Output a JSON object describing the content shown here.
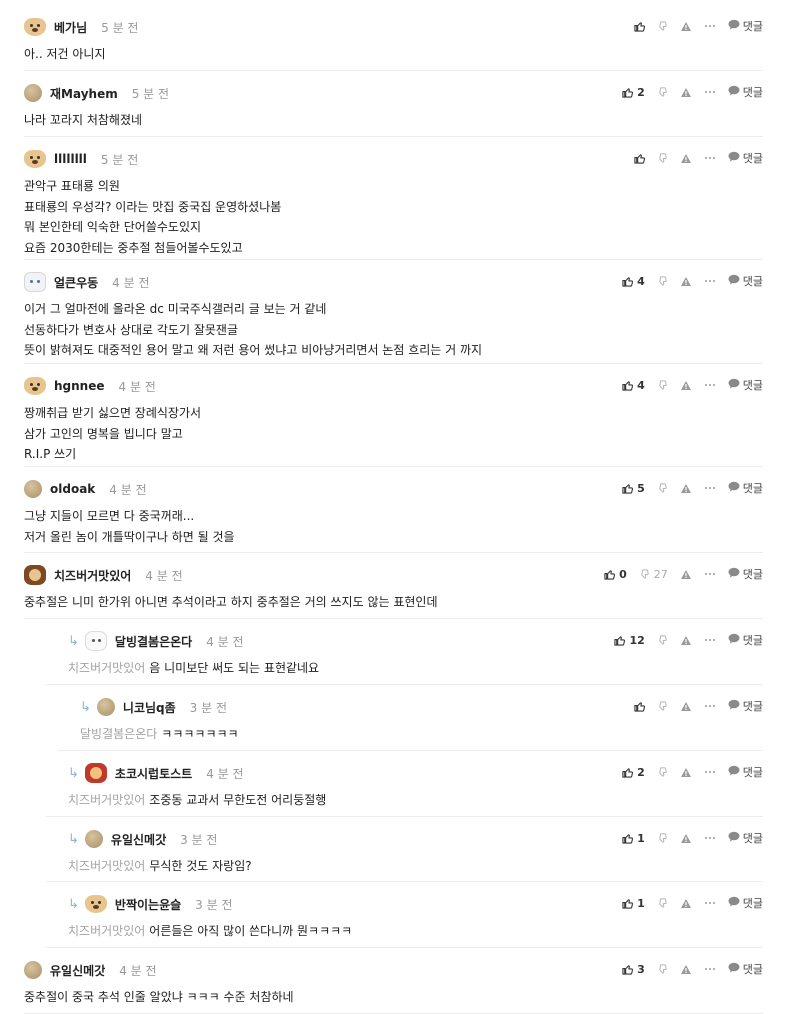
{
  "reply_label": "댓글",
  "comments": [
    {
      "nick": "베가님",
      "time": "5 분 전",
      "likes": "",
      "body": "아.. 저건 아니지",
      "avatar": "dog"
    },
    {
      "nick": "재Mayhem",
      "time": "5 분 전",
      "likes": "2",
      "body": "나라 꼬라지 처참해졌네",
      "avatar": "circle"
    },
    {
      "nick": "llllllll",
      "time": "5 분 전",
      "likes": "",
      "body": "관악구 표태룡 의원\n표태룡의 우성각? 이라는 맛집 중국집 운영하셨나봄\n뭐 본인한테 익숙한 단어쓸수도있지\n요즘 2030한테는 중추절 첨들어볼수도있고",
      "avatar": "dog"
    },
    {
      "nick": "얼큰우동",
      "time": "4 분 전",
      "likes": "4",
      "body": "이거 그 얼마전에 올라온 dc 미국주식갤러리 글 보는 거 같네\n선동하다가 변호사 상대로 각도기 잘못잰글\n뜻이 밝혀져도 대중적인 용어 말고 왜 저런 용어 썼냐고 비아냥거리면서 논점 흐리는 거 까지",
      "avatar": "cat"
    },
    {
      "nick": "hgnnee",
      "time": "4 분 전",
      "likes": "4",
      "body": "짱깨취급 받기 싫으면 장례식장가서\n삼가 고인의 명복을 빕니다 말고\nR.I.P 쓰기",
      "avatar": "dog"
    },
    {
      "nick": "oldoak",
      "time": "4 분 전",
      "likes": "5",
      "body": "그냥 지들이 모르면 다 중국꺼래...\n저거 올린 놈이 개틀딱이구나 하면 될 것을",
      "avatar": "circle"
    },
    {
      "nick": "치즈버거맛있어",
      "time": "4 분 전",
      "likes": "0",
      "dislikes": "27",
      "body": "중추절은 니미 한가위 아니면 추석이라고 하지 중추절은 거의 쓰지도 않는 표현인데",
      "avatar": "brown"
    },
    {
      "nick": "달빙결봄은온다",
      "time": "4 분 전",
      "likes": "12",
      "mention": "치즈버거맛있어",
      "body": "음 니미보단 써도 되는 표현같네요",
      "avatar": "snow",
      "reply": 1
    },
    {
      "nick": "니코님q좀",
      "time": "3 분 전",
      "likes": "",
      "mention": "달빙결봄은온다",
      "body": "ㅋㅋㅋㅋㅋㅋㅋ",
      "avatar": "circle",
      "reply": 2
    },
    {
      "nick": "초코시럽토스트",
      "time": "4 분 전",
      "likes": "2",
      "mention": "치즈버거맛있어",
      "body": "조중동 교과서 무한도전 어리둥절행",
      "avatar": "red",
      "reply": 1
    },
    {
      "nick": "유일신메갓",
      "time": "3 분 전",
      "likes": "1",
      "mention": "치즈버거맛있어",
      "body": "무식한 것도 자랑임?",
      "avatar": "circle",
      "reply": 1
    },
    {
      "nick": "반짝이는윤슬",
      "time": "3 분 전",
      "likes": "1",
      "mention": "치즈버거맛있어",
      "body": "어른들은 아직 많이 쓴다니까 뭔ㅋㅋㅋㅋ",
      "avatar": "dog",
      "reply": 1
    },
    {
      "nick": "유일신메갓",
      "time": "4 분 전",
      "likes": "3",
      "body": "중추절이 중국 추석 인줄 알았냐 ㅋㅋㅋ 수준 처참하네",
      "avatar": "circle"
    }
  ]
}
